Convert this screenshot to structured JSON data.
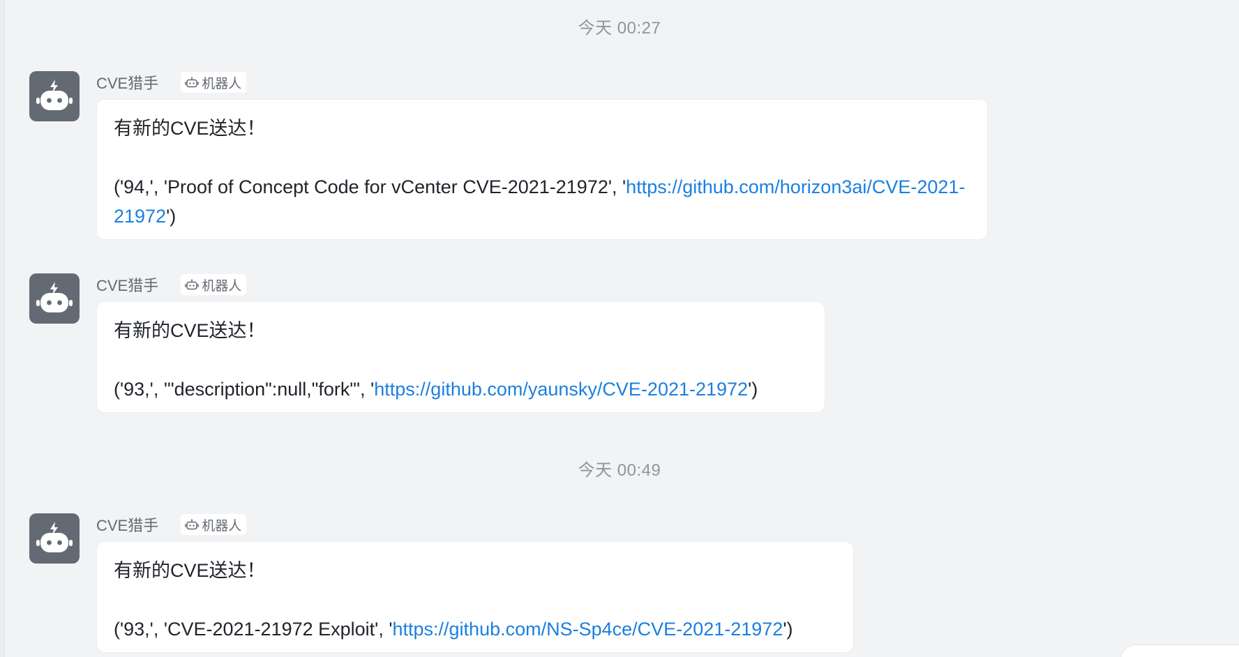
{
  "timestamps": [
    "今天 00:27",
    "今天 00:49"
  ],
  "messages": [
    {
      "sender": "CVE猎手",
      "tag": "机器人",
      "headline": "有新的CVE送达！",
      "prefix": "('94,', 'Proof of Concept Code for vCenter CVE-2021-21972', '",
      "link": "https://github.com/horizon3ai/CVE-2021-21972",
      "suffix": "')"
    },
    {
      "sender": "CVE猎手",
      "tag": "机器人",
      "headline": "有新的CVE送达！",
      "prefix": "('93,', '\"description\":null,\"fork\"', '",
      "link": "https://github.com/yaunsky/CVE-2021-21972",
      "suffix": "')"
    },
    {
      "sender": "CVE猎手",
      "tag": "机器人",
      "headline": "有新的CVE送达！",
      "prefix": "('93,', 'CVE-2021-21972 Exploit', '",
      "link": "https://github.com/NS-Sp4ce/CVE-2021-21972",
      "suffix": "')"
    }
  ],
  "colors": {
    "background": "#f2f3f5",
    "avatar": "#646a73",
    "link": "#1b7fe0",
    "text": "#1f2329",
    "muted": "#8f959e"
  },
  "icons": {
    "avatar": "robot-icon",
    "tag": "robot-icon"
  }
}
